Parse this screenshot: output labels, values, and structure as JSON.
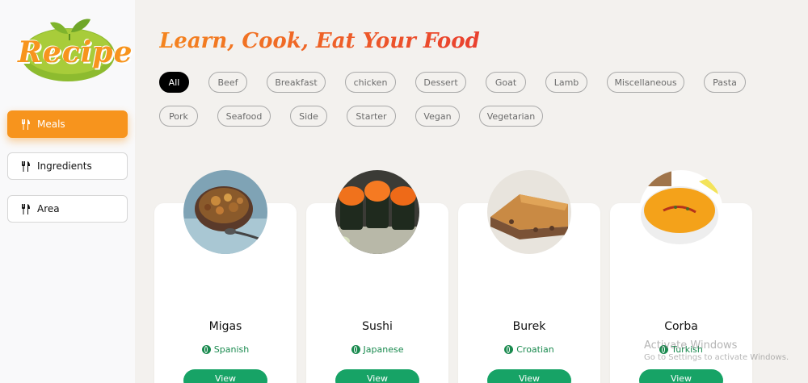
{
  "logo": {
    "text": "Recipe"
  },
  "nav": [
    {
      "label": "Meals",
      "active": true
    },
    {
      "label": "Ingredients",
      "active": false
    },
    {
      "label": "Area",
      "active": false
    }
  ],
  "header": {
    "title": "Learn, Cook, Eat Your Food"
  },
  "categories": [
    "All",
    "Beef",
    "Breakfast",
    "chicken",
    "Dessert",
    "Goat",
    "Lamb",
    "Miscellaneous",
    "Pasta",
    "Pork",
    "Seafood",
    "Side",
    "Starter",
    "Vegan",
    "Vegetarian"
  ],
  "selected_category": "All",
  "meals": [
    {
      "name": "Migas",
      "area": "Spanish",
      "button": "View"
    },
    {
      "name": "Sushi",
      "area": "Japanese",
      "button": "View"
    },
    {
      "name": "Burek",
      "area": "Croatian",
      "button": "View"
    },
    {
      "name": "Corba",
      "area": "Turkish",
      "button": "View"
    }
  ],
  "watermark": {
    "line1": "Activate Windows",
    "line2": "Go to Settings to activate Windows."
  },
  "colors": {
    "accent": "#f7941d",
    "title": "#e8552f",
    "area_text": "#1a8a4f",
    "view_button": "#17a366"
  }
}
